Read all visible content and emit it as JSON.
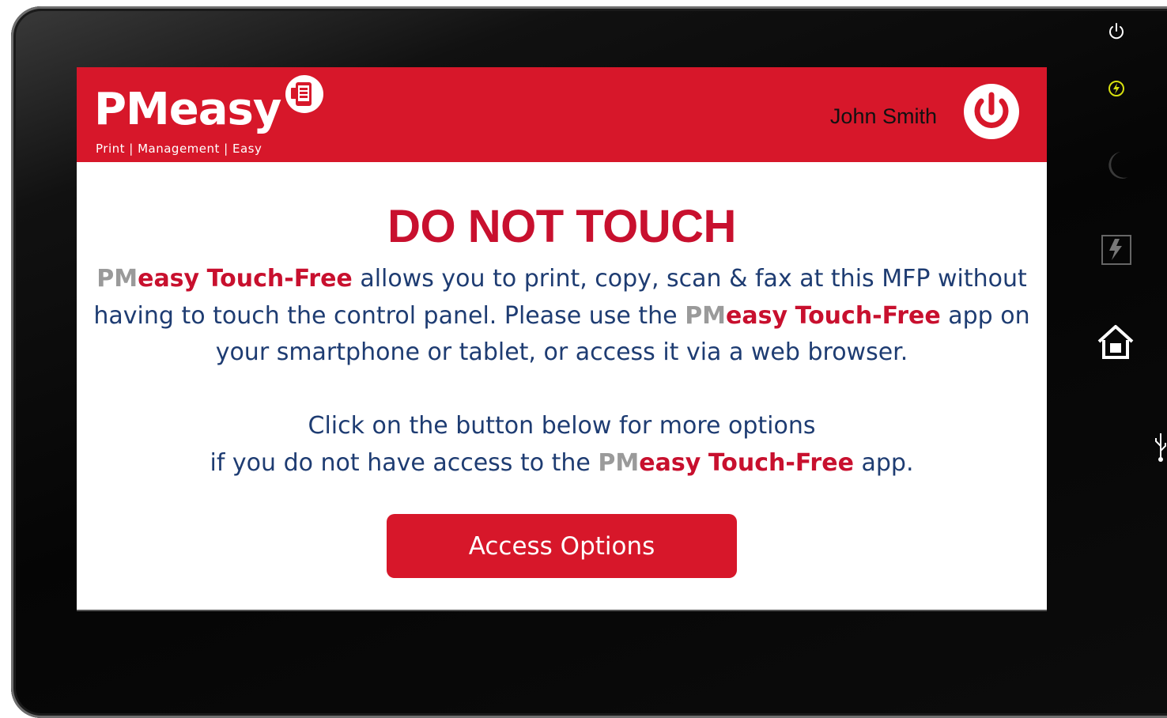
{
  "header": {
    "logo_text": "PMeasy",
    "logo_tagline": "Print | Management | Easy",
    "user_name": "John Smith"
  },
  "main": {
    "title": "DO NOT TOUCH",
    "msg1": {
      "brand_pm": "PM",
      "brand_easy": "easy",
      "brand_tf": "Touch-Free",
      "text_a": "allows you to print, copy, scan & fax at this MFP without having to touch the control panel.  Please use the",
      "brand_tf_b": "Touch-Free",
      "text_b": "app on your smartphone or tablet, or access it via a web browser."
    },
    "msg2": {
      "line1": "Click on the button below for more options",
      "line2_a": "if you do not have access to the",
      "brand_pm": "PM",
      "brand_easy": "easy",
      "brand_tf": "Touch-Free",
      "line2_b": "app."
    },
    "button_label": "Access Options"
  },
  "colors": {
    "brand_red": "#d7172a",
    "text_blue": "#1e3c72",
    "brand_grey": "#9a9a9a"
  },
  "icons": {
    "side": [
      "power-icon",
      "energy-saver-icon",
      "sleep-moon-icon",
      "fiery-icon",
      "home-icon",
      "usb-icon"
    ],
    "header": [
      "logout-power-icon",
      "logo-badge-icon"
    ]
  }
}
